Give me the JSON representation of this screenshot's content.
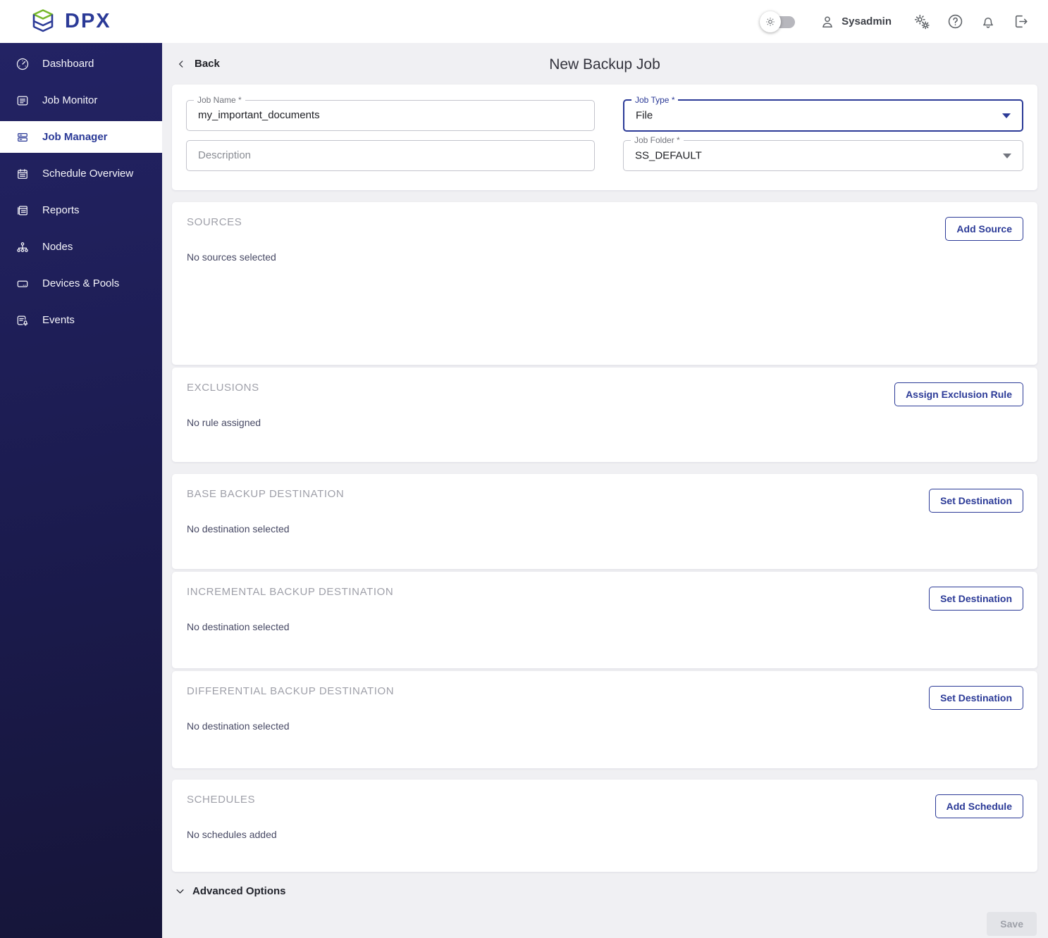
{
  "header": {
    "logo_text": "DPX",
    "user_name": "Sysadmin",
    "toggle_state": "off",
    "icons": [
      "gear-toggle-icon",
      "user-icon",
      "settings-gears-icon",
      "help-icon",
      "notifications-icon",
      "logout-icon"
    ]
  },
  "sidebar": {
    "items": [
      {
        "id": "dashboard",
        "label": "Dashboard",
        "icon": "dashboard",
        "active": false
      },
      {
        "id": "job-monitor",
        "label": "Job Monitor",
        "icon": "job-monitor",
        "active": false
      },
      {
        "id": "job-manager",
        "label": "Job Manager",
        "icon": "job-manager",
        "active": true
      },
      {
        "id": "schedule-overview",
        "label": "Schedule Overview",
        "icon": "schedule",
        "active": false
      },
      {
        "id": "reports",
        "label": "Reports",
        "icon": "reports",
        "active": false
      },
      {
        "id": "nodes",
        "label": "Nodes",
        "icon": "nodes",
        "active": false
      },
      {
        "id": "devices-pools",
        "label": "Devices & Pools",
        "icon": "devices",
        "active": false
      },
      {
        "id": "events",
        "label": "Events",
        "icon": "events",
        "active": false
      }
    ]
  },
  "page": {
    "back_label": "Back",
    "title": "New Backup Job"
  },
  "form": {
    "job_name": {
      "label": "Job Name *",
      "value": "my_important_documents"
    },
    "description": {
      "placeholder": "Description",
      "value": ""
    },
    "job_type": {
      "label": "Job Type *",
      "value": "File"
    },
    "job_folder": {
      "label": "Job Folder *",
      "value": "SS_DEFAULT"
    }
  },
  "sections": [
    {
      "id": "sources",
      "title": "SOURCES",
      "empty_text": "No sources selected",
      "button_label": "Add Source"
    },
    {
      "id": "exclusions",
      "title": "EXCLUSIONS",
      "empty_text": "No rule assigned",
      "button_label": "Assign Exclusion Rule"
    },
    {
      "id": "base-backup-destination",
      "title": "BASE BACKUP DESTINATION",
      "empty_text": "No destination selected",
      "button_label": "Set Destination"
    },
    {
      "id": "incremental-backup-destination",
      "title": "INCREMENTAL BACKUP DESTINATION",
      "empty_text": "No destination selected",
      "button_label": "Set Destination"
    },
    {
      "id": "differential-backup-destination",
      "title": "DIFFERENTIAL BACKUP DESTINATION",
      "empty_text": "No destination selected",
      "button_label": "Set Destination"
    },
    {
      "id": "schedules",
      "title": "SCHEDULES",
      "empty_text": "No schedules added",
      "button_label": "Add Schedule"
    }
  ],
  "footer": {
    "advanced_options_label": "Advanced Options",
    "save_label": "Save",
    "save_enabled": false
  },
  "colors": {
    "accent": "#2b3a97",
    "logo_green": "#76b82a",
    "sidebar_top": "#232364",
    "sidebar_bottom": "#161539",
    "page_bg": "#f0f0f3"
  }
}
